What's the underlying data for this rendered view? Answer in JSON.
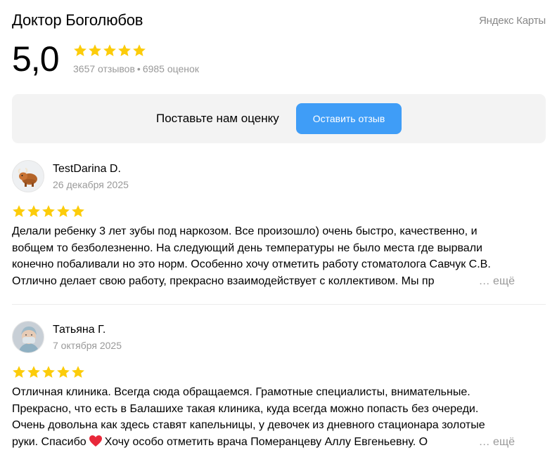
{
  "header": {
    "title": "Доктор Боголюбов",
    "brand": "Яндекс Карты"
  },
  "rating": {
    "value": "5,0",
    "stars": 5,
    "reviews_count": "3657 отзывов",
    "separator": "•",
    "ratings_count": "6985 оценок"
  },
  "cta": {
    "prompt": "Поставьте нам оценку",
    "button_label": "Оставить отзыв"
  },
  "reviews": [
    {
      "author": "TestDarina D.",
      "date": "26 декабря 2025",
      "stars": 5,
      "lines": [
        "Делали ребенку 3 лет зубы под наркозом. Все произошло) очень быстро, качественно, и",
        "вобщем то безболезненно. На следующий день температуры не было места где вырвали",
        "конечно побаливали но это норм. Особенно хочу отметить работу стоматолога Савчук С.В.",
        "Отлично делает свою работу, прекрасно взаимодействует с коллективом. Мы пр"
      ],
      "more": "… ещё",
      "avatar_icon": "yak-icon"
    },
    {
      "author": "Татьяна Г.",
      "date": "7 октября 2025",
      "stars": 5,
      "lines": [
        "Отличная клиника. Всегда сюда обращаемся. Грамотные специалисты, внимательные.",
        "Прекрасно, что есть в Балашихе такая клиника, куда всегда можно попасть без очереди.",
        "Очень довольна как здесь ставят капельницы, у девочек из дневного стационара золотые"
      ],
      "last_line_before_heart": "руки. Спасибо",
      "last_line_after_heart": "Хочу особо отметить врача Померанцеву Аллу Евгеньевну. О",
      "more": "… ещё",
      "avatar_icon": "user-photo-icon"
    }
  ],
  "colors": {
    "star": "#fccc0a",
    "button": "#3f9df7",
    "cta_background": "#f3f3f3",
    "muted_text": "#999999",
    "heart": "#e8283a"
  }
}
